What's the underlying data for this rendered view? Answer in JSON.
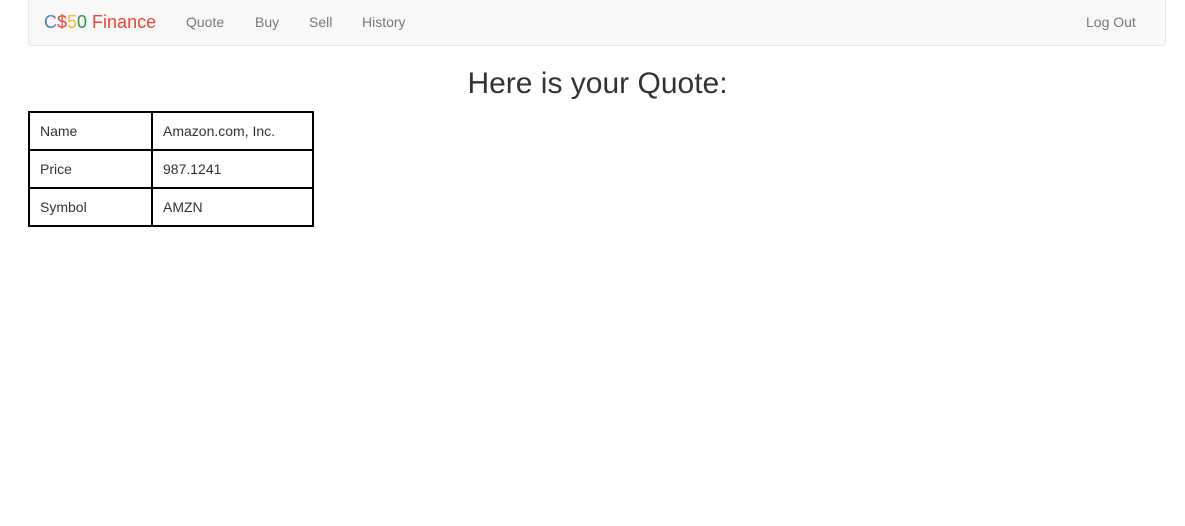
{
  "navbar": {
    "brand": {
      "parts": [
        {
          "text": "C",
          "color": "#537fbe"
        },
        {
          "text": "$",
          "color": "#ea433b"
        },
        {
          "text": "5",
          "color": "#f5b82e"
        },
        {
          "text": "0",
          "color": "#2e944b"
        },
        {
          "text": " Finance",
          "color": "#ea433b"
        }
      ]
    },
    "links": {
      "quote": "Quote",
      "buy": "Buy",
      "sell": "Sell",
      "history": "History"
    },
    "logout": "Log Out"
  },
  "main": {
    "title": "Here is your Quote:",
    "quote_table": [
      {
        "label": "Name",
        "value": "Amazon.com, Inc."
      },
      {
        "label": "Price",
        "value": "987.1241"
      },
      {
        "label": "Symbol",
        "value": "AMZN"
      }
    ]
  }
}
